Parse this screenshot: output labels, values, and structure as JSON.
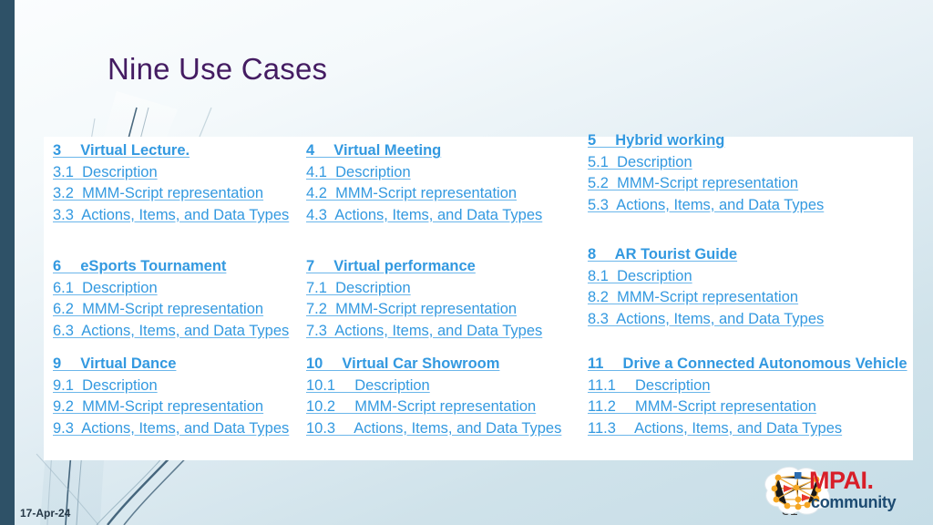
{
  "slide": {
    "title": "Nine Use Cases",
    "date": "17-Apr-24",
    "page_number": "31"
  },
  "colors": {
    "title": "#441c62",
    "link": "#3399e0",
    "left_bar": "#2e5167",
    "logo_mpai": "#d81e28",
    "logo_community": "#1d4b72",
    "panel": "#ffffff"
  },
  "logo": {
    "name": "MPAI.",
    "tagline": "community",
    "icon": "brain-network-icon"
  },
  "columns": [
    {
      "groups": [
        {
          "heading": "3  Virtual Lecture.",
          "items": [
            "3.1  Description",
            "3.2  MMM-Script representation",
            "3.3  Actions, Items, and Data Types"
          ]
        },
        {
          "heading": "6  eSports Tournament",
          "items": [
            "6.1  Description",
            "6.2  MMM-Script representation",
            "6.3  Actions, Items, and Data Types"
          ]
        },
        {
          "heading": "9  Virtual Dance",
          "items": [
            "9.1  Description",
            "9.2  MMM-Script representation",
            "9.3  Actions, Items, and Data Types"
          ]
        }
      ]
    },
    {
      "groups": [
        {
          "heading": "4  Virtual Meeting",
          "items": [
            "4.1  Description",
            "4.2  MMM-Script representation",
            "4.3  Actions, Items, and Data Types"
          ]
        },
        {
          "heading": "7  Virtual performance",
          "items": [
            "7.1  Description",
            "7.2  MMM-Script representation",
            "7.3  Actions, Items, and Data Types"
          ]
        },
        {
          "heading": "10  Virtual Car Showroom",
          "items": [
            "10.1  Description",
            "10.2  MMM-Script representation",
            "10.3  Actions, Items, and Data Types"
          ]
        }
      ]
    },
    {
      "groups": [
        {
          "heading": "5  Hybrid working",
          "items": [
            "5.1  Description",
            "5.2  MMM-Script representation",
            "5.3  Actions, Items, and Data Types"
          ]
        },
        {
          "heading": "8  AR Tourist Guide",
          "items": [
            "8.1  Description",
            "8.2  MMM-Script representation",
            "8.3  Actions, Items, and Data Types"
          ]
        },
        {
          "heading": "11  Drive a Connected Autonomous Vehicle",
          "items": [
            "11.1  Description",
            "11.2  MMM-Script representation",
            "11.3  Actions, Items, and Data Types"
          ]
        }
      ]
    }
  ]
}
